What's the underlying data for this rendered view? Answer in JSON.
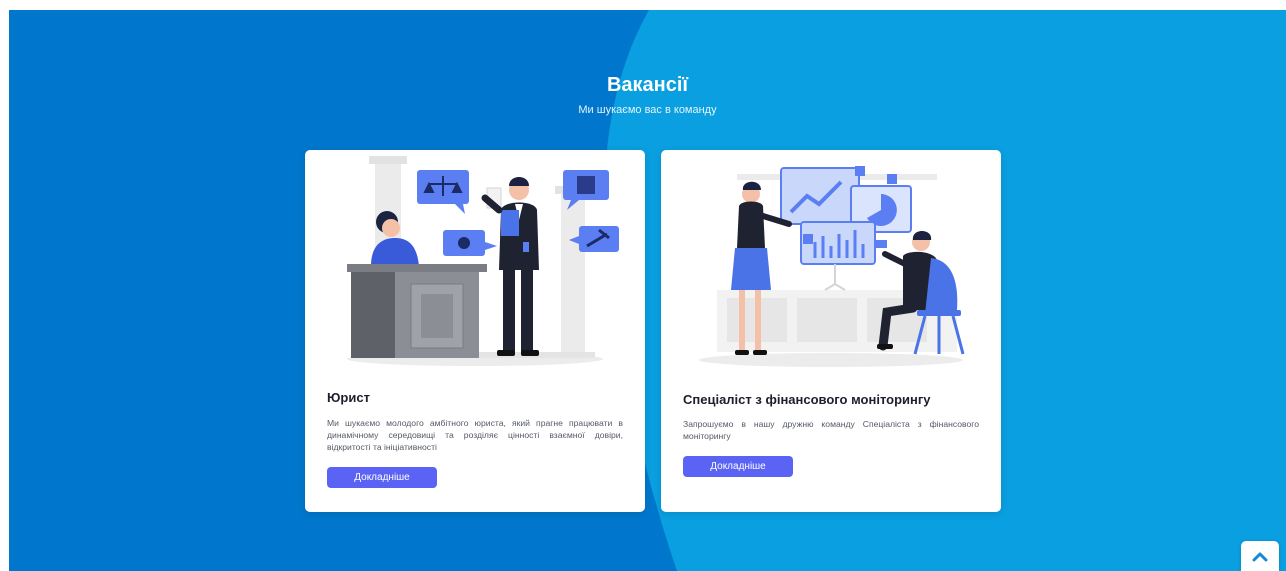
{
  "section": {
    "title": "Вакансії",
    "subtitle": "Ми шукаємо вас в команду"
  },
  "vacancies": [
    {
      "title": "Юрист",
      "description": "Ми шукаємо молодого амбітного юриста, який прагне працювати в динамічному середовищі та розділяє цінності взаємної довіри, відкритості та ініціативності",
      "button_label": "Докладніше",
      "illustration_icon": "lawyer-illustration-icon"
    },
    {
      "title": "Спеціаліст з фінансового моніторингу",
      "description": "Запрошуємо в нашу дружню команду Спеціаліста з фінансового моніторингу",
      "button_label": "Докладніше",
      "illustration_icon": "financial-analysis-illustration-icon"
    }
  ],
  "scroll_top": {
    "icon": "chevron-up-icon"
  },
  "colors": {
    "background_dark": "#0077cc",
    "background_light": "#0a9fe0",
    "button": "#5b63f5",
    "card": "#ffffff",
    "title_text": "#1e1e2d",
    "body_text": "#555a66",
    "scroll_icon": "#1689d6"
  }
}
